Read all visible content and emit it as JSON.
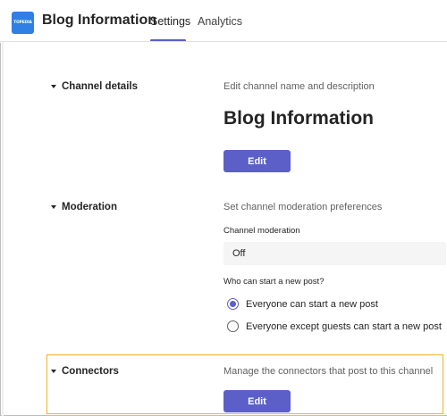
{
  "header": {
    "logo_text": "TOPEDIA",
    "title": "Blog Information",
    "tabs": [
      {
        "label": "Settings",
        "active": true
      },
      {
        "label": "Analytics",
        "active": false
      }
    ],
    "accent_color": "#5b5fc7"
  },
  "sections": {
    "channel_details": {
      "label": "Channel details",
      "description": "Edit channel name and description",
      "channel_name": "Blog Information",
      "edit_label": "Edit"
    },
    "moderation": {
      "label": "Moderation",
      "description": "Set channel moderation preferences",
      "field_label": "Channel moderation",
      "field_value": "Off",
      "question": "Who can start a new post?",
      "options": [
        {
          "label": "Everyone can start a new post",
          "selected": true
        },
        {
          "label": "Everyone except guests can start a new post",
          "selected": false
        }
      ]
    },
    "connectors": {
      "label": "Connectors",
      "description": "Manage the connectors that post to this channel",
      "edit_label": "Edit",
      "highlight_color": "#f2b12d"
    }
  }
}
